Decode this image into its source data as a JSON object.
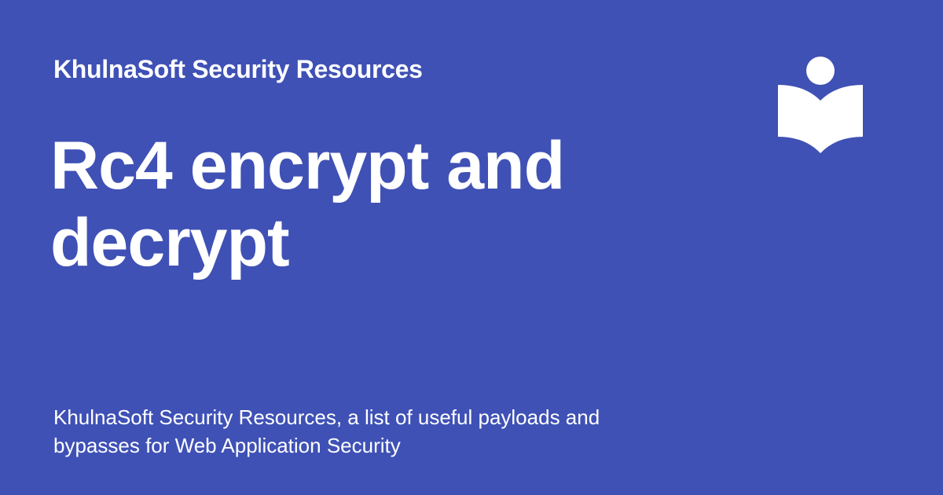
{
  "site_name": "KhulnaSoft Security Resources",
  "page_title": "Rc4 encrypt and decrypt",
  "description": "KhulnaSoft Security Resources, a list of useful payloads and bypasses for Web Application Security",
  "logo_icon": "book-reader-icon",
  "colors": {
    "background": "#3f51b5",
    "text": "#ffffff"
  }
}
